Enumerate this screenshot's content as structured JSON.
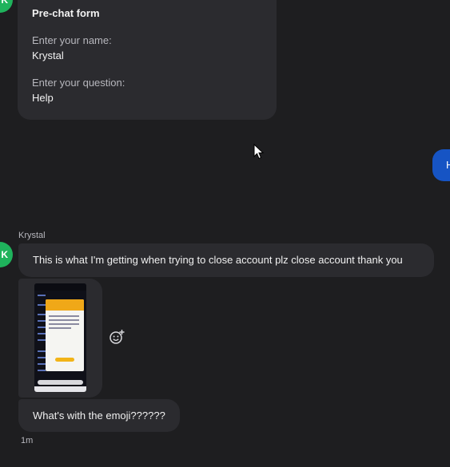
{
  "avatars": {
    "top_initial": "K",
    "krystal_initial": "K",
    "color": "#1fb35c"
  },
  "prechat": {
    "title": "Pre-chat form",
    "name_label": "Enter your name:",
    "name_value": "Krystal",
    "question_label": "Enter your question:",
    "question_value": "Help"
  },
  "outgoing": {
    "text": "H",
    "color": "#1654c4"
  },
  "thread": {
    "sender": "Krystal",
    "message_1": "This is what I'm getting when trying to close account plz close account thank you",
    "attachment": {
      "kind": "image",
      "icon": "phone-screenshot-thumbnail"
    },
    "message_2": "What's with the emoji??????",
    "timestamp": "1m"
  },
  "actions": {
    "reaction_icon": "add-reaction-icon"
  },
  "colors": {
    "background": "#1e1e20",
    "bubble": "#2b2b2f",
    "text_secondary": "#b7b7bd"
  }
}
